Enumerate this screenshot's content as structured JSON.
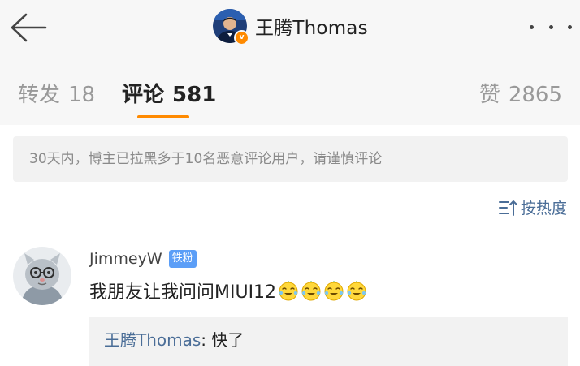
{
  "header": {
    "title": "王腾Thomas",
    "back_icon": "arrow-left-icon",
    "more_icon": "more-horizontal-icon",
    "verified_badge": "v"
  },
  "tabs": {
    "repost": {
      "label": "转发",
      "count": "18"
    },
    "comments": {
      "label": "评论",
      "count": "581"
    },
    "likes": {
      "label": "赞",
      "count": "2865"
    },
    "active": "comments",
    "accent_color": "#ff8a00"
  },
  "notice": {
    "text": "30天内，博主已拉黑多于10名恶意评论用户，请谨慎评论"
  },
  "sort": {
    "label": "按热度",
    "icon": "sort-icon"
  },
  "comment": {
    "username": "JimmeyW",
    "badge": "铁粉",
    "text": "我朋友让我问问MIUI12",
    "emoji_count": 4,
    "emoji_icon": "laughing-tears-emoji",
    "reply": {
      "author": "王腾Thomas",
      "separator": ": ",
      "text": "快了"
    }
  },
  "colors": {
    "link_blue": "#4a6d97",
    "badge_blue": "#5b9ef7",
    "header_bg": "#f7f7f7",
    "notice_bg": "#f2f2f2"
  }
}
